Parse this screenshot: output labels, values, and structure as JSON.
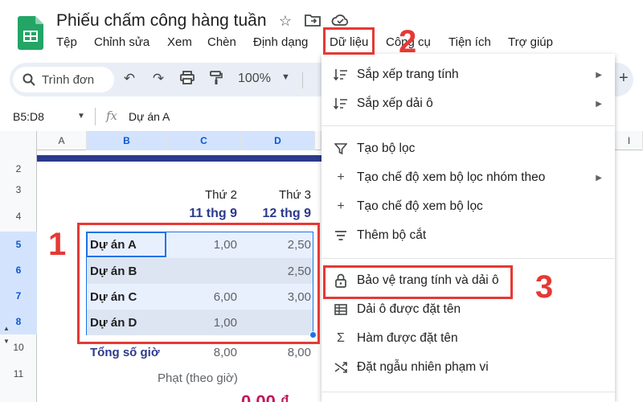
{
  "app": {
    "title": "Phiếu chấm công hàng tuần",
    "title_icons": [
      "star-icon",
      "move-to-folder-icon",
      "cloud-status-icon"
    ]
  },
  "menu": {
    "items": [
      "Tệp",
      "Chỉnh sửa",
      "Xem",
      "Chèn",
      "Định dạng",
      "Dữ liệu",
      "Công cụ",
      "Tiện ích",
      "Trợ giúp"
    ],
    "active": "Dữ liệu"
  },
  "toolbar": {
    "search_placeholder": "Trình đơn",
    "zoom": "100%"
  },
  "formula_bar": {
    "name_box": "B5:D8",
    "fx": "fx",
    "value": "Dự án A"
  },
  "grid": {
    "columns": [
      "A",
      "B",
      "C",
      "D",
      "I"
    ],
    "rows": [
      "2",
      "3",
      "4",
      "5",
      "6",
      "7",
      "8",
      "10",
      "11"
    ],
    "day_labels": [
      "Thứ 2",
      "Thứ 3"
    ],
    "date_labels": [
      "11 thg 9",
      "12 thg 9"
    ],
    "projects": [
      {
        "name": "Dự án A",
        "mon": "1,00",
        "tue": "2,50"
      },
      {
        "name": "Dự án B",
        "mon": "",
        "tue": "2,50"
      },
      {
        "name": "Dự án C",
        "mon": "6,00",
        "tue": "3,00"
      },
      {
        "name": "Dự án D",
        "mon": "1,00",
        "tue": ""
      }
    ],
    "total_label": "Tổng số giờ",
    "total_mon": "8,00",
    "total_tue": "8,00",
    "penalty_label": "Phạt (theo giờ)",
    "partial_value": "0,00 ₫"
  },
  "dropdown": {
    "items": [
      {
        "label": "Sắp xếp trang tính",
        "icon": "sort-icon",
        "submenu": true
      },
      {
        "label": "Sắp xếp dải ô",
        "icon": "sort-icon",
        "submenu": true
      },
      {
        "label": "Tạo bộ lọc",
        "icon": "filter-icon",
        "submenu": false
      },
      {
        "label": "Tạo chế độ xem bộ lọc nhóm theo",
        "icon": "plus-icon",
        "submenu": true
      },
      {
        "label": "Tạo chế độ xem bộ lọc",
        "icon": "plus-icon",
        "submenu": false
      },
      {
        "label": "Thêm bộ cắt",
        "icon": "slicer-icon",
        "submenu": false
      },
      {
        "label": "Bảo vệ trang tính và dải ô",
        "icon": "lock-icon",
        "submenu": false
      },
      {
        "label": "Dải ô được đặt tên",
        "icon": "named-range-icon",
        "submenu": false
      },
      {
        "label": "Hàm được đặt tên",
        "icon": "sigma-icon",
        "submenu": false
      },
      {
        "label": "Đặt ngẫu nhiên phạm vi",
        "icon": "shuffle-icon",
        "submenu": false
      }
    ]
  },
  "annotations": {
    "step1": "1",
    "step2": "2",
    "step3": "3",
    "color": "#e53935"
  }
}
